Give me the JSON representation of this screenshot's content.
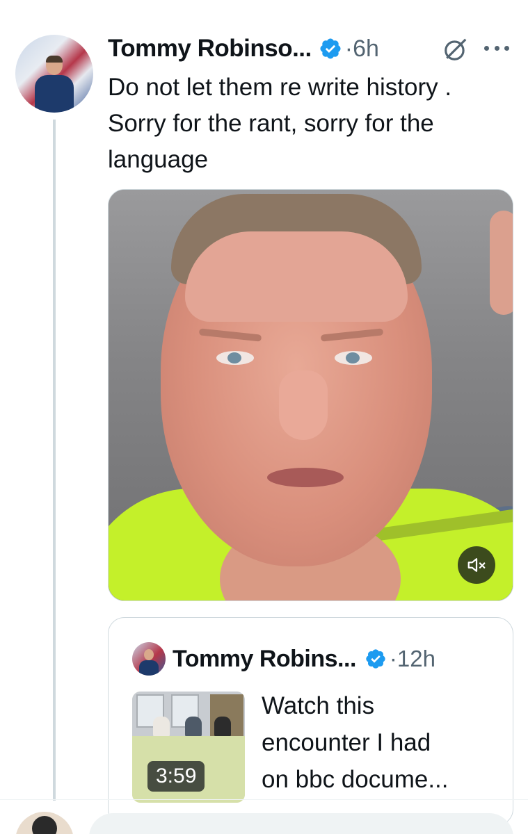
{
  "tweet": {
    "author_name": "Tommy Robinso...",
    "time": "·6h",
    "text": "Do not let them re write history .\nSorry for the rant, sorry for the\nlanguage",
    "verified_color": "#1d9bf0"
  },
  "quoted_tweet": {
    "author_name": "Tommy Robins...",
    "time": "·12h",
    "video_duration": "3:59",
    "text": "Watch this\nencounter I had\non bbc docume..."
  },
  "icons": {
    "verified": "verified-badge-icon",
    "grok": "grok-icon",
    "more": "more-icon",
    "mute": "mute-icon"
  }
}
